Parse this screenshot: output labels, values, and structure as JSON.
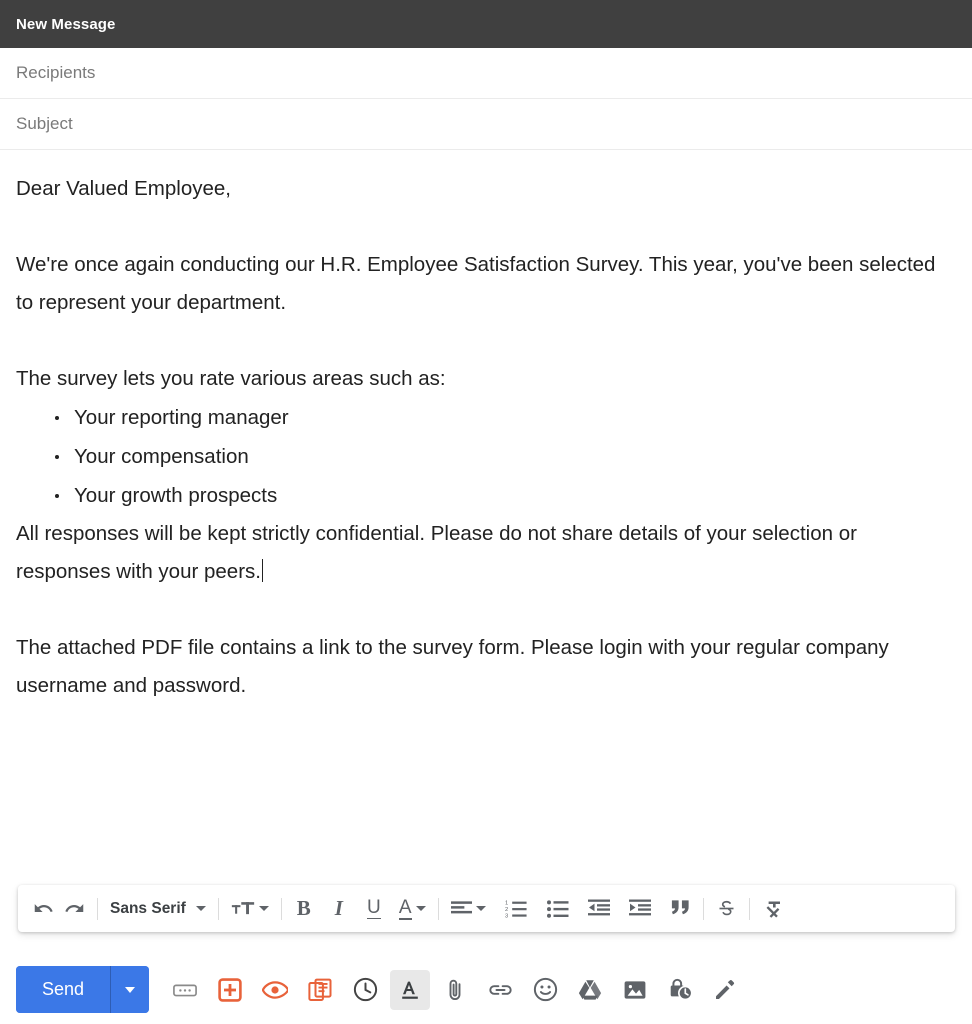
{
  "header": {
    "title": "New Message"
  },
  "fields": {
    "recipients_placeholder": "Recipients",
    "subject_placeholder": "Subject"
  },
  "body": {
    "greeting": "Dear Valued Employee,",
    "paragraph_1": "We're once again conducting our H.R. Employee Satisfaction Survey. This year, you've been selected to represent your department.",
    "paragraph_2": "The survey lets you rate various areas such as:",
    "bullets": [
      "Your reporting manager",
      "Your compensation",
      "Your growth prospects"
    ],
    "paragraph_3": "All responses will be kept strictly confidential. Please do not share details of your selection or responses with your peers.",
    "paragraph_4": "The attached PDF file contains a link to the survey form. Please login with your regular company username and password."
  },
  "format_toolbar": {
    "undo_label": "Undo",
    "redo_label": "Redo",
    "font_name": "Sans Serif",
    "font_size_label": "Font size",
    "bold_label": "B",
    "italic_label": "I",
    "underline_label": "U",
    "text_color_label": "Text color",
    "align_label": "Align",
    "numbered_list_label": "Numbered list",
    "bulleted_list_label": "Bulleted list",
    "outdent_label": "Decrease indent",
    "indent_label": "Increase indent",
    "quote_label": "Quote",
    "strikethrough_label": "Strikethrough",
    "remove_format_label": "Remove formatting"
  },
  "action_bar": {
    "send_label": "Send",
    "send_options_label": "More send options",
    "icons": [
      {
        "name": "more-options",
        "label": "More options"
      },
      {
        "name": "insert-template",
        "label": "Templates"
      },
      {
        "name": "read-receipt",
        "label": "Track"
      },
      {
        "name": "document-stack",
        "label": "Insert document"
      },
      {
        "name": "schedule-send",
        "label": "Schedule send"
      },
      {
        "name": "formatting-options",
        "label": "Formatting options"
      },
      {
        "name": "attach-file",
        "label": "Attach files"
      },
      {
        "name": "insert-link",
        "label": "Insert link"
      },
      {
        "name": "insert-emoji",
        "label": "Insert emoji"
      },
      {
        "name": "insert-drive-file",
        "label": "Insert files using Drive"
      },
      {
        "name": "insert-photo",
        "label": "Insert photo"
      },
      {
        "name": "confidential-mode",
        "label": "Toggle confidential mode"
      },
      {
        "name": "insert-signature",
        "label": "Insert signature"
      }
    ]
  },
  "colors": {
    "header_bg": "#404040",
    "send_blue": "#3b78e7",
    "accent_orange": "#e8623a",
    "icon_gray": "#5f6368",
    "active_bg": "#e8e8e8"
  }
}
